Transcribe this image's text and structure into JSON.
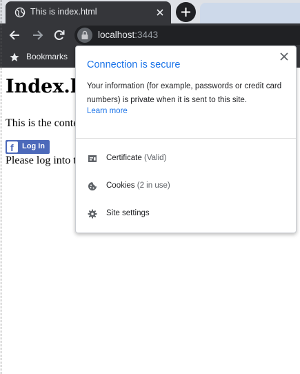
{
  "browser": {
    "tab": {
      "title": "This is index.html"
    },
    "address_bar": {
      "host": "localhost",
      "port": ":3443"
    },
    "bookmarks_bar": {
      "label": "Bookmarks"
    }
  },
  "page": {
    "heading": "Index.h",
    "paragraph": "This is the conte",
    "login_button": "Log In",
    "login_prompt": "Please log into t"
  },
  "site_info_popup": {
    "title": "Connection is secure",
    "description": "Your information (for example, passwords or credit card numbers) is private when it is sent to this site.",
    "learn_more": "Learn more",
    "rows": [
      {
        "label": "Certificate",
        "sub": "(Valid)",
        "icon": "certificate-icon"
      },
      {
        "label": "Cookies",
        "sub": "(2 in use)",
        "icon": "cookie-icon"
      },
      {
        "label": "Site settings",
        "sub": "",
        "icon": "gear-icon"
      }
    ]
  },
  "colors": {
    "tab_bg": "#35363a",
    "tabstrip_bg": "#dee1e6",
    "link_blue": "#1a73e8",
    "facebook_blue": "#4c69ba"
  }
}
